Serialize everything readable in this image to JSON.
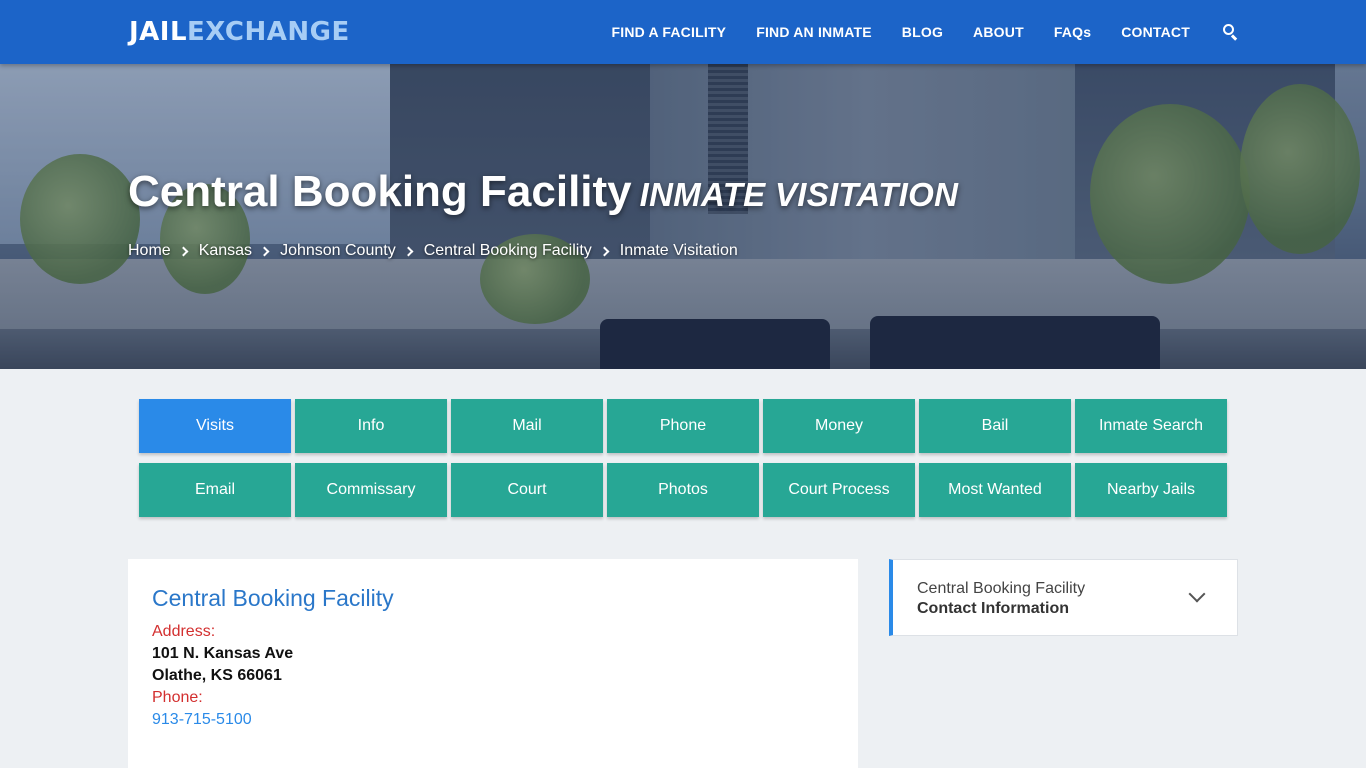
{
  "header": {
    "logo_part1": "JAIL",
    "logo_part2": "EXCHANGE",
    "nav": [
      "FIND A FACILITY",
      "FIND AN INMATE",
      "BLOG",
      "ABOUT",
      "FAQs",
      "CONTACT"
    ],
    "search_icon": "search-icon"
  },
  "hero": {
    "title": "Central Booking Facility",
    "subtitle": "INMATE VISITATION",
    "breadcrumbs": [
      "Home",
      "Kansas",
      "Johnson County",
      "Central Booking Facility"
    ],
    "breadcrumb_current": "Inmate Visitation"
  },
  "tabs": {
    "row1": [
      "Visits",
      "Info",
      "Mail",
      "Phone",
      "Money",
      "Bail",
      "Inmate Search"
    ],
    "row2": [
      "Email",
      "Commissary",
      "Court",
      "Photos",
      "Court Process",
      "Most Wanted",
      "Nearby Jails"
    ],
    "active": "Visits"
  },
  "facility_card": {
    "title": "Central Booking Facility",
    "address_label": "Address:",
    "address_line1": "101 N. Kansas Ave",
    "address_line2": "Olathe, KS 66061",
    "phone_label": "Phone:",
    "phone": "913-715-5100"
  },
  "sidebar": {
    "line1": "Central Booking Facility",
    "line2": "Contact Information"
  },
  "colors": {
    "header_bg": "#1c64c8",
    "tab_bg": "#27a795",
    "tab_active": "#2a8ae8",
    "label_red": "#d32f2f",
    "link_blue": "#2a8ae8"
  }
}
